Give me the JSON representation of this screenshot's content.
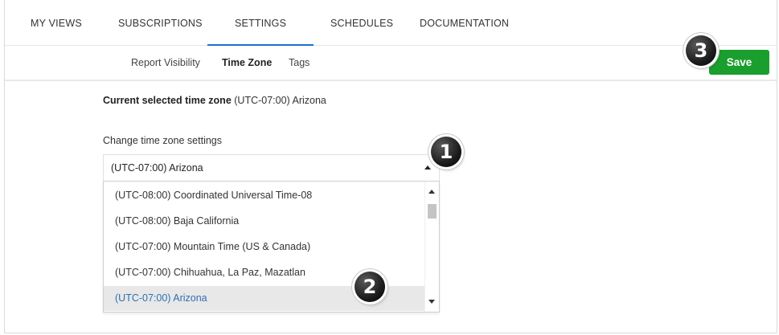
{
  "top_nav": {
    "tabs": [
      {
        "label": "MY VIEWS",
        "active": false
      },
      {
        "label": "SUBSCRIPTIONS",
        "active": false
      },
      {
        "label": "SETTINGS",
        "active": true
      },
      {
        "label": "SCHEDULES",
        "active": false
      },
      {
        "label": "DOCUMENTATION",
        "active": false
      }
    ],
    "accent_color": "#1a73c8"
  },
  "sub_nav": {
    "tabs": [
      {
        "label": "Report Visibility",
        "active": false
      },
      {
        "label": "Time Zone",
        "active": true
      },
      {
        "label": "Tags",
        "active": false
      }
    ]
  },
  "save_button": {
    "label": "Save",
    "color": "#1a9e2e"
  },
  "callouts": [
    "1",
    "2",
    "3"
  ],
  "time_zone": {
    "current_label": "Current selected time zone",
    "current_value": "(UTC-07:00) Arizona",
    "change_label": "Change time zone settings",
    "selected_value": "(UTC-07:00) Arizona",
    "options": [
      "(UTC-08:00) Coordinated Universal Time-08",
      "(UTC-08:00) Baja California",
      "(UTC-07:00) Mountain Time (US & Canada)",
      "(UTC-07:00) Chihuahua, La Paz, Mazatlan",
      "(UTC-07:00) Arizona"
    ],
    "highlighted_option_index": 4
  }
}
